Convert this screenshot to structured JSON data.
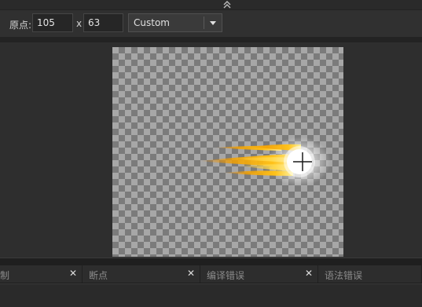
{
  "toolbar": {
    "origin_label": "原点:",
    "origin_x": "105",
    "separator": "x",
    "origin_y": "63",
    "preset": "Custom"
  },
  "tabs": [
    {
      "label": "制"
    },
    {
      "label": "断点"
    },
    {
      "label": "编译错误"
    },
    {
      "label": "语法错误"
    }
  ],
  "icons": {
    "collapse": "chevron-up-double-icon",
    "close": "close-icon",
    "dropdown": "chevron-down-icon",
    "crosshair": "crosshair-icon"
  },
  "colors": {
    "flame_core": "#fff2a0",
    "flame_mid": "#ffc21a",
    "flame_outer": "#f28b00"
  }
}
